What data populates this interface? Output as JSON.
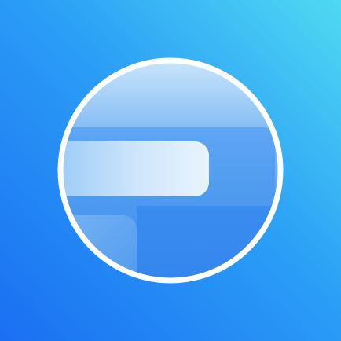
{
  "icon": {
    "name": "app-logo-icon",
    "colors": {
      "background_top_right": "#4fd9f2",
      "background_mid": "#2b9ef6",
      "background_bottom_left": "#1a6ff2",
      "ring": "#ffffff",
      "lens_top": "#cfe8fb",
      "lens_bottom": "#2f86ef",
      "bar_light": "#e3f1fc",
      "bar_mid": "#8cc3f5",
      "panel": "#6ba9f0"
    }
  }
}
